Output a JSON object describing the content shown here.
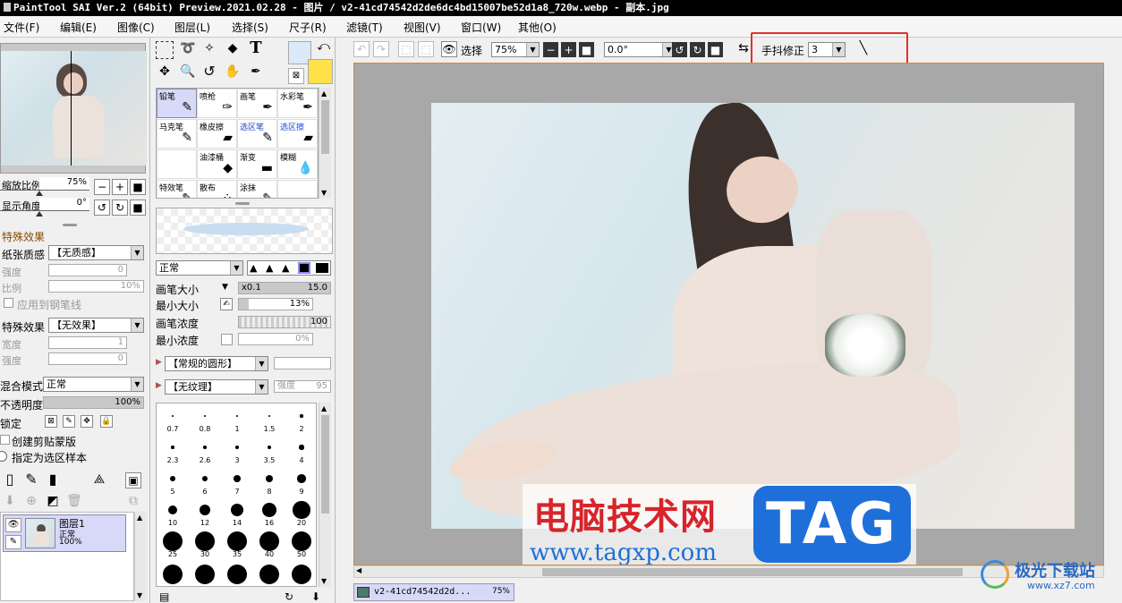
{
  "window": {
    "title": "PaintTool SAI Ver.2 (64bit) Preview.2021.02.28 - 图片 / v2-41cd74542d2de6dc4bd15007be52d1a8_720w.webp - 副本.jpg"
  },
  "menu": [
    "文件(F)",
    "编辑(E)",
    "图像(C)",
    "图层(L)",
    "选择(S)",
    "尺子(R)",
    "滤镜(T)",
    "视图(V)",
    "窗口(W)",
    "其他(O)"
  ],
  "navigator": {
    "zoom_label": "缩放比例",
    "zoom_value": "75%",
    "angle_label": "显示角度",
    "angle_value": "0°"
  },
  "effects": {
    "section": "特殊效果",
    "paper_label": "纸张质感",
    "paper_value": "【无质感】",
    "strength_label": "强度",
    "strength_value": "0",
    "ratio_label": "比例",
    "ratio_value": "10%",
    "apply_pen": "应用到钢笔线",
    "effect_label": "特殊效果",
    "effect_value": "【无效果】",
    "width_label": "宽度",
    "width_value": "1",
    "strength2_label": "强度",
    "strength2_value": "0"
  },
  "layer": {
    "blend_label": "混合模式",
    "blend_value": "正常",
    "opacity_label": "不透明度",
    "opacity_value": "100%",
    "lock_label": "锁定",
    "clip_label": "创建剪贴蒙版",
    "sample_label": "指定为选区样本",
    "item_name": "图层1",
    "item_mode": "正常",
    "item_opacity": "100%"
  },
  "brushes": [
    {
      "name": "铅笔",
      "icon": "✎",
      "active": true
    },
    {
      "name": "喷枪",
      "icon": "✑"
    },
    {
      "name": "画笔",
      "icon": "✒"
    },
    {
      "name": "水彩笔",
      "icon": "✒"
    },
    {
      "name": "马克笔",
      "icon": "✎"
    },
    {
      "name": "橡皮擦",
      "icon": "▰"
    },
    {
      "name": "选区笔",
      "icon": "✎",
      "blue": true
    },
    {
      "name": "选区擦",
      "icon": "▰",
      "blue": true
    },
    {
      "name": "",
      "icon": ""
    },
    {
      "name": "油漆桶",
      "icon": "◆"
    },
    {
      "name": "渐变",
      "icon": "▬"
    },
    {
      "name": "模糊",
      "icon": "💧"
    },
    {
      "name": "特效笔",
      "icon": "✎"
    },
    {
      "name": "散布",
      "icon": "⁘"
    },
    {
      "name": "涂抹",
      "icon": "✎"
    },
    {
      "name": "",
      "icon": ""
    }
  ],
  "brush_props": {
    "mode": "正常",
    "size_label": "画笔大小",
    "size_mult": "x0.1",
    "size_value": "15.0",
    "min_size_label": "最小大小",
    "min_size_value": "13%",
    "density_label": "画笔浓度",
    "density_value": "100",
    "min_density_label": "最小浓度",
    "min_density_value": "0%",
    "shape": "【常规的圆形】",
    "texture": "【无纹理】",
    "texture_strength": "强度",
    "texture_strength_value": "95"
  },
  "brush_sizes": [
    "0.7",
    "0.8",
    "1",
    "1.5",
    "2",
    "2.3",
    "2.6",
    "3",
    "3.5",
    "4",
    "5",
    "6",
    "7",
    "8",
    "9",
    "10",
    "12",
    "14",
    "16",
    "20",
    "25",
    "30",
    "35",
    "40",
    "50"
  ],
  "toolbar": {
    "select_label": "选择",
    "zoom": "75%",
    "angle": "0.0°",
    "stabilizer_label": "手抖修正",
    "stabilizer_value": "3"
  },
  "watermark": {
    "text1": "电脑技术网",
    "text2": "TAG",
    "url": "www.tagxp.com",
    "logo": "极光下载站",
    "logo_url": "www.xz7.com"
  },
  "tab": {
    "label": "v2-41cd74542d2d...",
    "zoom": "75%"
  },
  "colors": {
    "accent": "#d8d8f8",
    "primary_color": "#ffe14a",
    "secondary_color": "#dbe9f8",
    "highlight_box": "#e03030",
    "tag_blue": "#1e6fd9"
  }
}
